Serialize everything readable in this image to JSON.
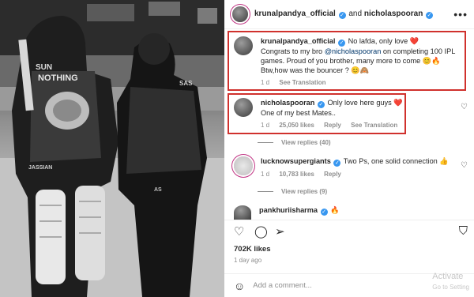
{
  "post": {
    "header": {
      "author": "krunalpandya_official",
      "joiner": "and",
      "collaborator": "nicholaspooran",
      "more_icon": "more-horizontal-icon"
    },
    "comments": [
      {
        "user": "krunalpandya_official",
        "text_prefix": "No lafda, only love ❤️",
        "line2a": "Congrats to my bro ",
        "mention": "@nicholaspooran",
        "line2b": " on completing 100 IPL",
        "line3": "games. Proud of you brother, many more to come 😊🔥",
        "line4": "Btw,how was the bouncer ? 😊🙈",
        "time": "1 d",
        "action": "See Translation"
      },
      {
        "user": "nicholaspooran",
        "text": "Only love here guys ❤️",
        "line2": "One of my best Mates..",
        "time": "1 d",
        "likes": "25,050 likes",
        "reply": "Reply",
        "action": "See Translation",
        "replies": "View replies (40)"
      },
      {
        "user": "lucknowsupergiants",
        "text": "Two Ps, one solid connection 👍",
        "time": "1 d",
        "likes": "10,783 likes",
        "reply": "Reply",
        "replies": "View replies (9)"
      },
      {
        "user": "pankhuriisharma",
        "text": "🔥"
      }
    ],
    "likes": "702K likes",
    "age": "1 day ago",
    "add_comment_placeholder": "Add a comment...",
    "watermark_line1": "Activate",
    "watermark_line2": "Go to Setting"
  },
  "photo": {
    "jersey_text_1": "SUN",
    "jersey_text_2": "NOTHING",
    "jersey_text_3": "JASSIAN",
    "jersey_text_4": "SAS",
    "jersey_text_5": "AS"
  },
  "colors": {
    "highlight_box": "#d0312d",
    "link": "#00376b",
    "verified": "#3897f0",
    "secondary_text": "#8e8e8e"
  }
}
